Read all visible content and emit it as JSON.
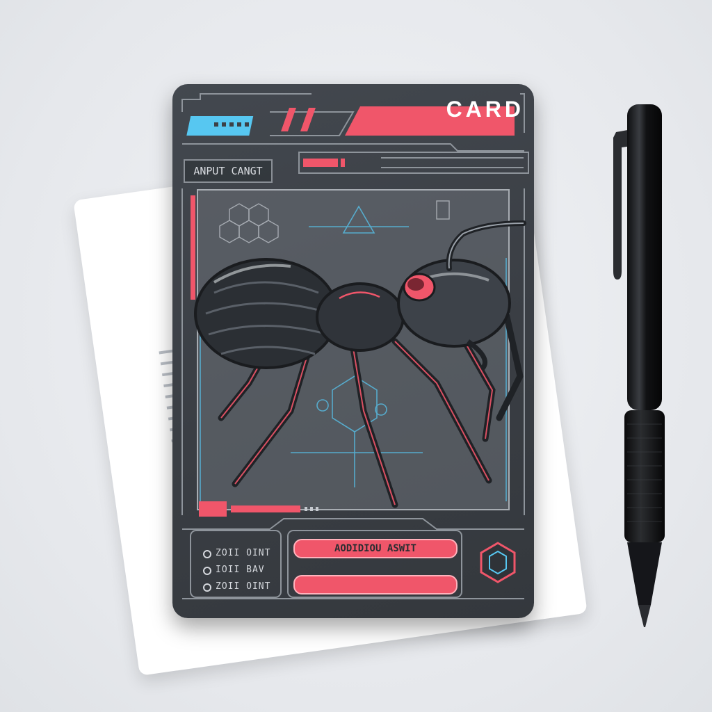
{
  "card": {
    "label": "CARD",
    "subtitle": "ANPUT CANGT",
    "primary_button": "AODIDIOU ASWIT",
    "secondary_button": "",
    "stats": [
      {
        "label": "ZOII OINT"
      },
      {
        "label": "IOII BAV"
      },
      {
        "label": "ZOII OINT"
      }
    ]
  },
  "colors": {
    "accent_pink": "#f0566a",
    "accent_cyan": "#57c7f1",
    "card_body": "#3c4046",
    "frame_line": "#8e949b",
    "background": "#e8eaed"
  },
  "icons": {
    "emblem": "hexagon-emblem-icon",
    "creature": "ant-illustration"
  }
}
